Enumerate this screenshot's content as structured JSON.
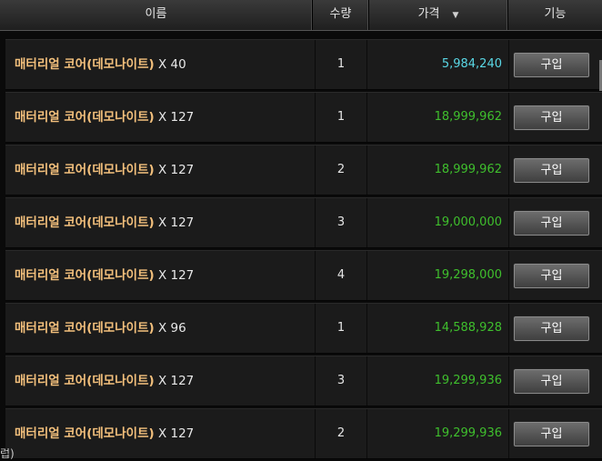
{
  "header": {
    "name": "이름",
    "qty": "수량",
    "price": "가격",
    "sort_icon": "▼",
    "func": "기능"
  },
  "colors": {
    "cyan_price": "#5ad8e6",
    "green_price": "#3fbf2d",
    "item_name": "#f3c07c"
  },
  "rows": [
    {
      "item": "매터리얼 코어(데모나이트)",
      "count": "X 40",
      "qty": "1",
      "price": "5,984,240",
      "price_color": "cyan",
      "button": "구입"
    },
    {
      "item": "매터리얼 코어(데모나이트)",
      "count": "X 127",
      "qty": "1",
      "price": "18,999,962",
      "price_color": "green",
      "button": "구입"
    },
    {
      "item": "매터리얼 코어(데모나이트)",
      "count": "X 127",
      "qty": "2",
      "price": "18,999,962",
      "price_color": "green",
      "button": "구입"
    },
    {
      "item": "매터리얼 코어(데모나이트)",
      "count": "X 127",
      "qty": "3",
      "price": "19,000,000",
      "price_color": "green",
      "button": "구입"
    },
    {
      "item": "매터리얼 코어(데모나이트)",
      "count": "X 127",
      "qty": "4",
      "price": "19,298,000",
      "price_color": "green",
      "button": "구입"
    },
    {
      "item": "매터리얼 코어(데모나이트)",
      "count": "X 96",
      "qty": "1",
      "price": "14,588,928",
      "price_color": "green",
      "button": "구입"
    },
    {
      "item": "매터리얼 코어(데모나이트)",
      "count": "X 127",
      "qty": "3",
      "price": "19,299,936",
      "price_color": "green",
      "button": "구입"
    },
    {
      "item": "매터리얼 코어(데모나이트)",
      "count": "X 127",
      "qty": "2",
      "price": "19,299,936",
      "price_color": "green",
      "button": "구입"
    }
  ],
  "footer": {
    "text": "럽)"
  }
}
